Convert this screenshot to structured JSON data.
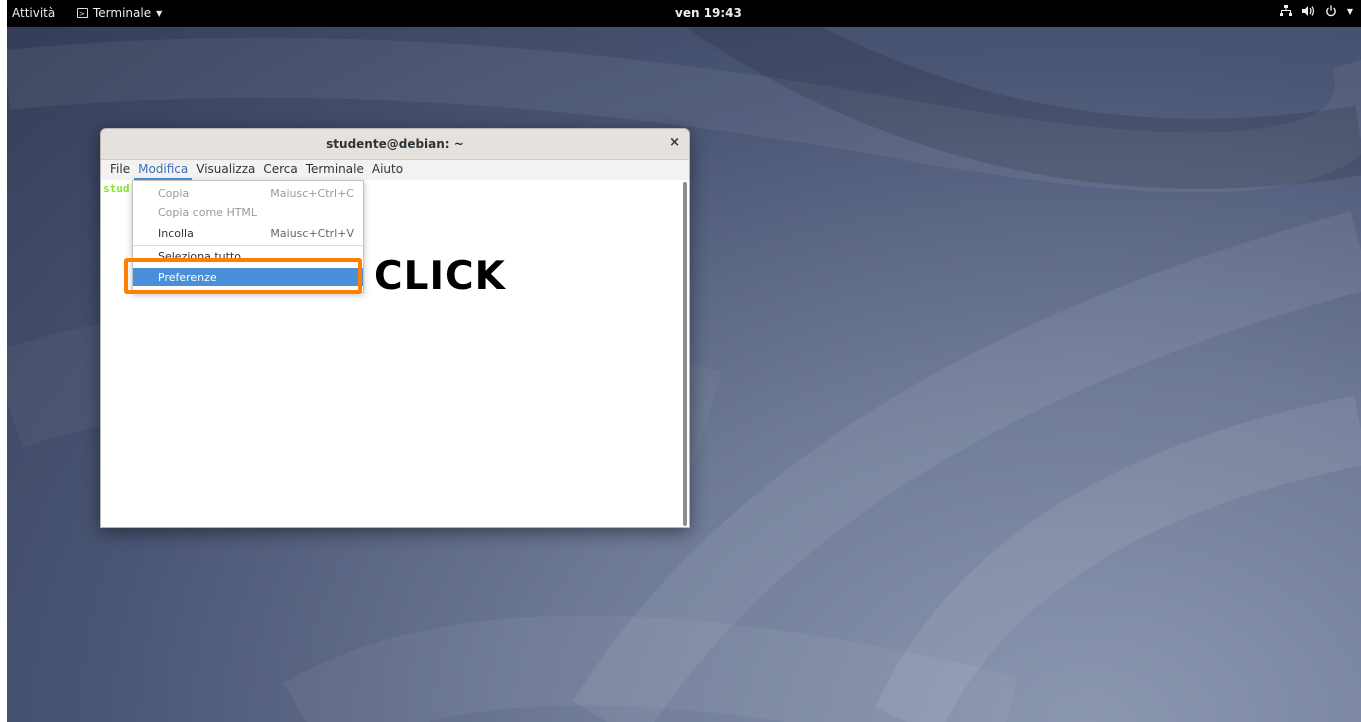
{
  "topbar": {
    "activities": "Attività",
    "app_name": "Terminale",
    "clock": "ven 19:43",
    "tray_icons": [
      "network-icon",
      "volume-icon",
      "power-icon"
    ]
  },
  "window": {
    "title": "studente@debian: ~",
    "close_glyph": "×",
    "prompt": "stud"
  },
  "menubar": {
    "items": [
      "File",
      "Modifica",
      "Visualizza",
      "Cerca",
      "Terminale",
      "Aiuto"
    ],
    "active": "Modifica"
  },
  "dropdown": {
    "items": [
      {
        "label": "Copia",
        "accel": "Maiusc+Ctrl+C",
        "enabled": false
      },
      {
        "label": "Copia come HTML",
        "accel": "",
        "enabled": false
      },
      {
        "label": "Incolla",
        "accel": "Maiusc+Ctrl+V",
        "enabled": true
      },
      {
        "label": "Seleziona tutto",
        "accel": "",
        "enabled": true
      },
      {
        "label": "Preferenze",
        "accel": "",
        "enabled": true,
        "selected": true
      }
    ]
  },
  "annotation": {
    "text": "CLICK",
    "color": "#ff7f00"
  },
  "colors": {
    "topbar": "#000000",
    "selection": "#4a90d9",
    "prompt": "#8ae234"
  }
}
